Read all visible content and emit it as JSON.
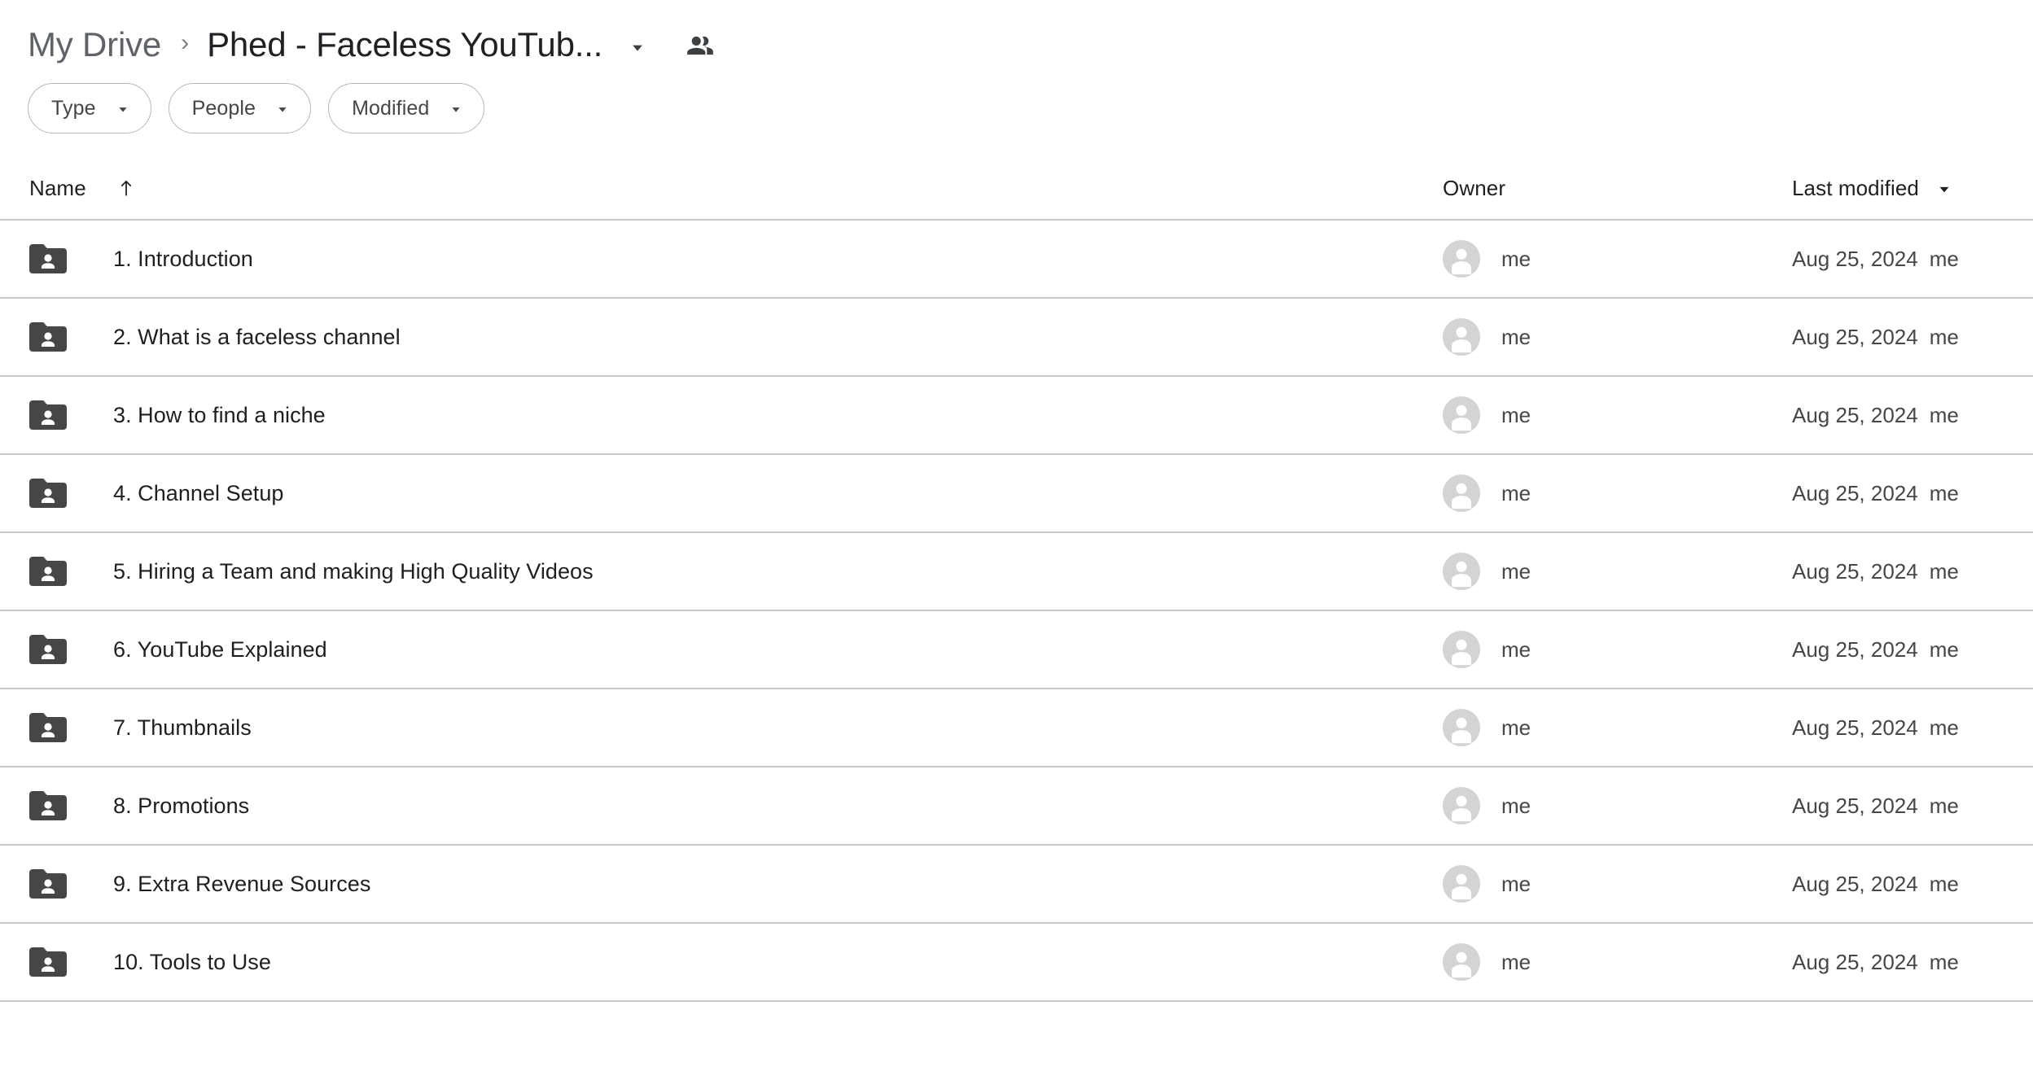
{
  "breadcrumb": {
    "root_label": "My Drive",
    "separator": "›",
    "current_label": "Phed - Faceless YouTub...",
    "caret_icon": "chevron-down-icon",
    "share_icon": "people-shared-icon"
  },
  "filters": {
    "chips": [
      {
        "label": "Type",
        "caret_icon": "chevron-down-icon"
      },
      {
        "label": "People",
        "caret_icon": "chevron-down-icon"
      },
      {
        "label": "Modified",
        "caret_icon": "chevron-down-icon"
      }
    ]
  },
  "table": {
    "columns": {
      "name": "Name",
      "owner": "Owner",
      "modified": "Last modified"
    },
    "sort": {
      "column": "Name",
      "direction": "ascending",
      "arrow_icon": "arrow-up-icon"
    },
    "modified_caret_icon": "chevron-down-icon",
    "rows": [
      {
        "icon": "shared-folder-icon",
        "name": "1. Introduction",
        "owner": "me",
        "owner_avatar": "person-avatar-icon",
        "modified_date": "Aug 25, 2024",
        "modified_by": "me"
      },
      {
        "icon": "shared-folder-icon",
        "name": "2. What is a faceless channel",
        "owner": "me",
        "owner_avatar": "person-avatar-icon",
        "modified_date": "Aug 25, 2024",
        "modified_by": "me"
      },
      {
        "icon": "shared-folder-icon",
        "name": "3. How to find a niche",
        "owner": "me",
        "owner_avatar": "person-avatar-icon",
        "modified_date": "Aug 25, 2024",
        "modified_by": "me"
      },
      {
        "icon": "shared-folder-icon",
        "name": "4. Channel Setup",
        "owner": "me",
        "owner_avatar": "person-avatar-icon",
        "modified_date": "Aug 25, 2024",
        "modified_by": "me"
      },
      {
        "icon": "shared-folder-icon",
        "name": "5. Hiring a Team and making High Quality Videos",
        "owner": "me",
        "owner_avatar": "person-avatar-icon",
        "modified_date": "Aug 25, 2024",
        "modified_by": "me"
      },
      {
        "icon": "shared-folder-icon",
        "name": "6. YouTube Explained",
        "owner": "me",
        "owner_avatar": "person-avatar-icon",
        "modified_date": "Aug 25, 2024",
        "modified_by": "me"
      },
      {
        "icon": "shared-folder-icon",
        "name": "7. Thumbnails",
        "owner": "me",
        "owner_avatar": "person-avatar-icon",
        "modified_date": "Aug 25, 2024",
        "modified_by": "me"
      },
      {
        "icon": "shared-folder-icon",
        "name": "8. Promotions",
        "owner": "me",
        "owner_avatar": "person-avatar-icon",
        "modified_date": "Aug 25, 2024",
        "modified_by": "me"
      },
      {
        "icon": "shared-folder-icon",
        "name": "9. Extra Revenue Sources",
        "owner": "me",
        "owner_avatar": "person-avatar-icon",
        "modified_date": "Aug 25, 2024",
        "modified_by": "me"
      },
      {
        "icon": "shared-folder-icon",
        "name": "10. Tools to Use",
        "owner": "me",
        "owner_avatar": "person-avatar-icon",
        "modified_date": "Aug 25, 2024",
        "modified_by": "me"
      }
    ]
  },
  "colors": {
    "text_primary": "#1f1f1f",
    "text_secondary": "#444746",
    "breadcrumb_root": "#5f6368",
    "folder_icon": "#444746",
    "avatar_bg": "#d3d4d5",
    "divider": "#c7c7c7",
    "chip_border": "#b4b8bb",
    "background": "#ffffff"
  }
}
